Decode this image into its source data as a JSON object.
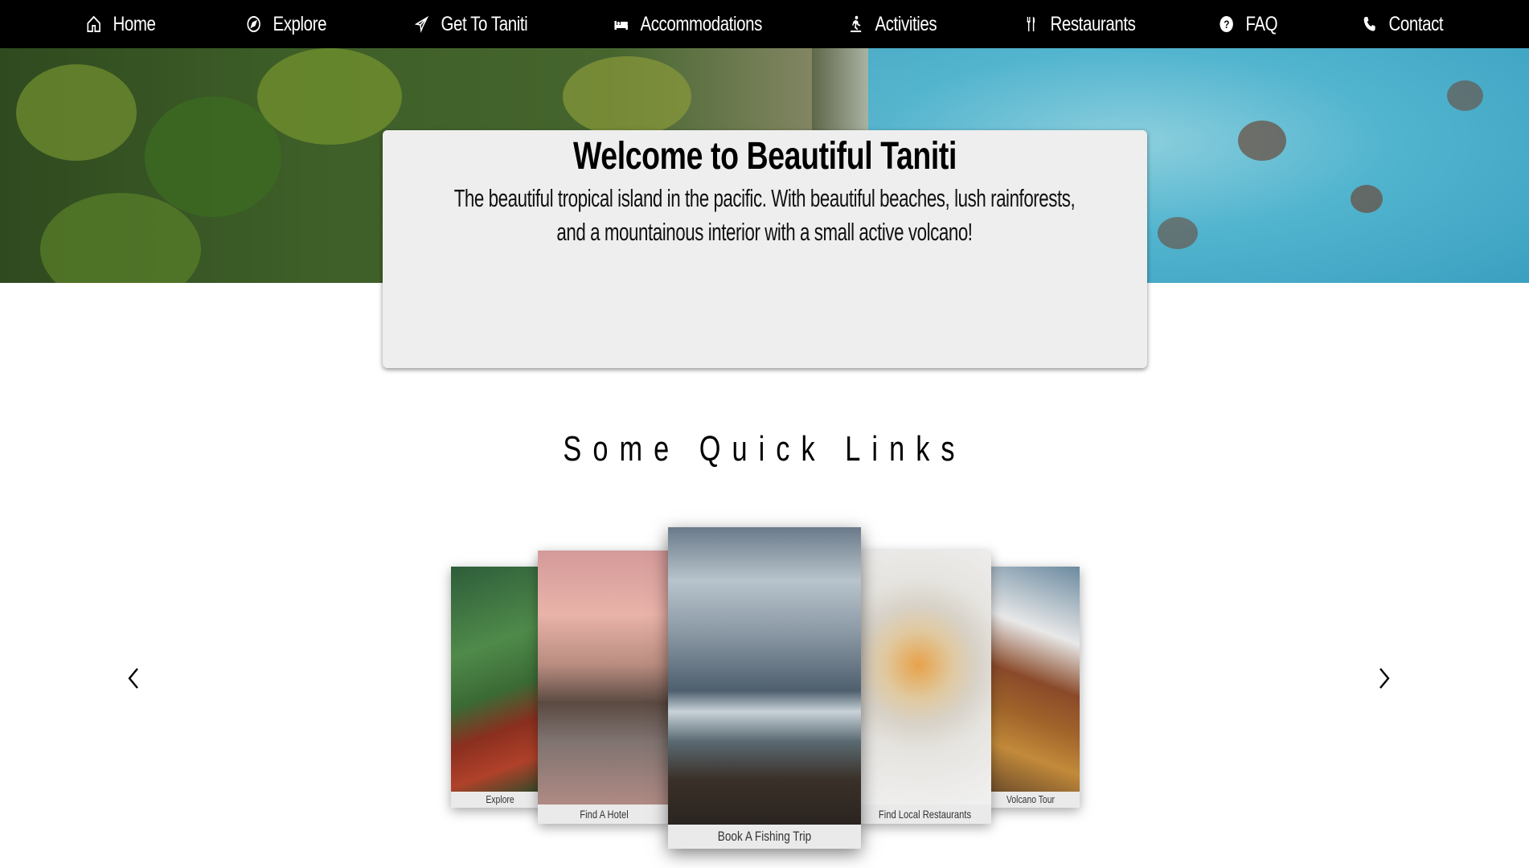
{
  "nav": {
    "items": [
      {
        "label": "Home",
        "icon": "home-icon"
      },
      {
        "label": "Explore",
        "icon": "compass-icon"
      },
      {
        "label": "Get To Taniti",
        "icon": "plane-icon"
      },
      {
        "label": "Accommodations",
        "icon": "bed-icon"
      },
      {
        "label": "Activities",
        "icon": "activity-icon"
      },
      {
        "label": "Restaurants",
        "icon": "utensils-icon"
      },
      {
        "label": "FAQ",
        "icon": "question-icon"
      },
      {
        "label": "Contact",
        "icon": "phone-icon"
      }
    ]
  },
  "welcome": {
    "title": "Welcome to Beautiful Taniti",
    "text": "The beautiful tropical island in the pacific. With beautiful beaches, lush rainforests, and a mountainous interior with a small active volcano!"
  },
  "quick_links": {
    "title": "Some Quick Links",
    "cards": [
      {
        "label": "Explore"
      },
      {
        "label": "Find A Hotel"
      },
      {
        "label": "Book A Fishing Trip"
      },
      {
        "label": "Find Local Restaurants"
      },
      {
        "label": "Volcano Tour"
      }
    ],
    "prev_icon": "chevron-left-icon",
    "next_icon": "chevron-right-icon"
  },
  "colors": {
    "nav_bg": "#000000",
    "nav_text": "#ffffff",
    "card_bg": "#eeeeee"
  }
}
